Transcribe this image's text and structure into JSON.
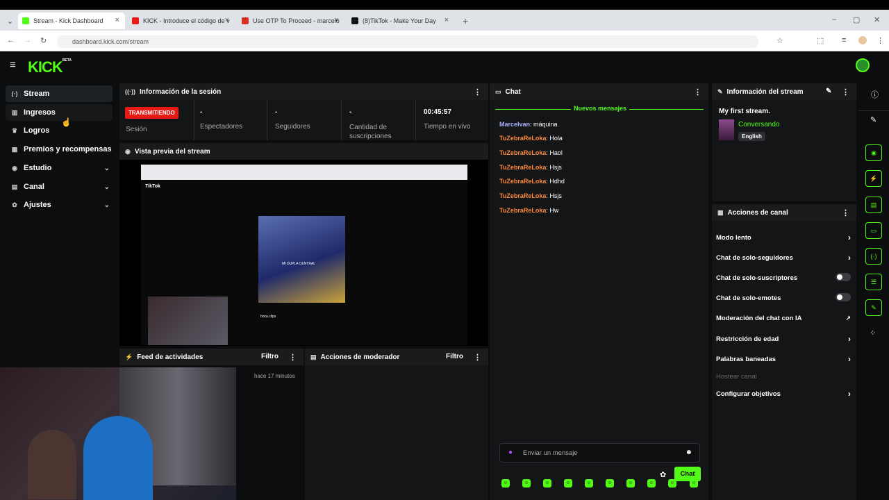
{
  "browser": {
    "tabs": [
      {
        "label": "Stream - Kick Dashboard",
        "color": "#53fc18"
      },
      {
        "label": "KICK - Introduce el código de v",
        "color": "#e91916"
      },
      {
        "label": "Use OTP To Proceed - marcelo",
        "color": "#d93025"
      },
      {
        "label": "(8)TikTok - Make Your Day",
        "color": "#111111"
      }
    ],
    "url": "dashboard.kick.com/stream"
  },
  "app": {
    "logo": "KICK",
    "logo_tag": "BETA",
    "sidebar": [
      {
        "label": "Stream",
        "icon": "broadcast-icon"
      },
      {
        "label": "Ingresos",
        "icon": "chart-icon"
      },
      {
        "label": "Logros",
        "icon": "trophy-icon"
      },
      {
        "label": "Premios y recompensas",
        "icon": "gift-icon"
      },
      {
        "label": "Estudio",
        "icon": "studio-icon"
      },
      {
        "label": "Canal",
        "icon": "channel-icon"
      },
      {
        "label": "Ajustes",
        "icon": "gear-icon"
      }
    ],
    "session": {
      "title": "Información de la sesión",
      "live_badge": "TRANSMITIENDO",
      "session_label": "Sesión",
      "stats": [
        {
          "value": "-",
          "label": "Espectadores"
        },
        {
          "value": "-",
          "label": "Seguidores"
        },
        {
          "value": "-",
          "label": "Cantidad de suscripciones"
        },
        {
          "value": "00:45:57",
          "label": "Tiempo en vivo"
        }
      ]
    },
    "preview": {
      "title": "Vista previa del stream",
      "preview_logo": "TikTok",
      "overlay_text": "MI DUPLA CENTRAL",
      "caption": "boca.clips"
    },
    "feed": {
      "title": "Feed de actividades",
      "filter": "Filtro",
      "timestamp": "hace 17 minutos"
    },
    "mod": {
      "title": "Acciones de moderador",
      "filter": "Filtro"
    },
    "chat": {
      "title": "Chat",
      "new_messages": "Nuevos mensajes",
      "messages": [
        {
          "user": "Marcelvan",
          "text": ": máquina",
          "type": "u1"
        },
        {
          "user": "TuZebraReLoka",
          "text": ": Hola",
          "type": "u2"
        },
        {
          "user": "TuZebraReLoka",
          "text": ": Haol",
          "type": "u2"
        },
        {
          "user": "TuZebraReLoka",
          "text": ": Hsjs",
          "type": "u2"
        },
        {
          "user": "TuZebraReLoka",
          "text": ": Hdhd",
          "type": "u2"
        },
        {
          "user": "TuZebraReLoka",
          "text": ": Hsjs",
          "type": "u2"
        },
        {
          "user": "TuZebraReLoka",
          "text": ": Hw",
          "type": "u2"
        }
      ],
      "placeholder": "Enviar un mensaje",
      "send_label": "Chat"
    },
    "stream_info": {
      "title": "Información del stream",
      "stream_title": "My first stream.",
      "category": "Conversando",
      "language": "English"
    },
    "channel_actions": {
      "title": "Acciones de canal",
      "items": [
        {
          "label": "Modo lento",
          "control": "chevron"
        },
        {
          "label": "Chat de solo-seguidores",
          "control": "chevron"
        },
        {
          "label": "Chat de solo-suscriptores",
          "control": "toggle"
        },
        {
          "label": "Chat de solo-emotes",
          "control": "toggle"
        },
        {
          "label": "Moderación del chat con IA",
          "control": "external"
        },
        {
          "label": "Restricción de edad",
          "control": "chevron"
        },
        {
          "label": "Palabras baneadas",
          "control": "chevron"
        },
        {
          "label": "Hostear canal",
          "control": "disabled"
        },
        {
          "label": "Configurar objetivos",
          "control": "chevron"
        }
      ]
    },
    "accent": "#53fc18"
  }
}
